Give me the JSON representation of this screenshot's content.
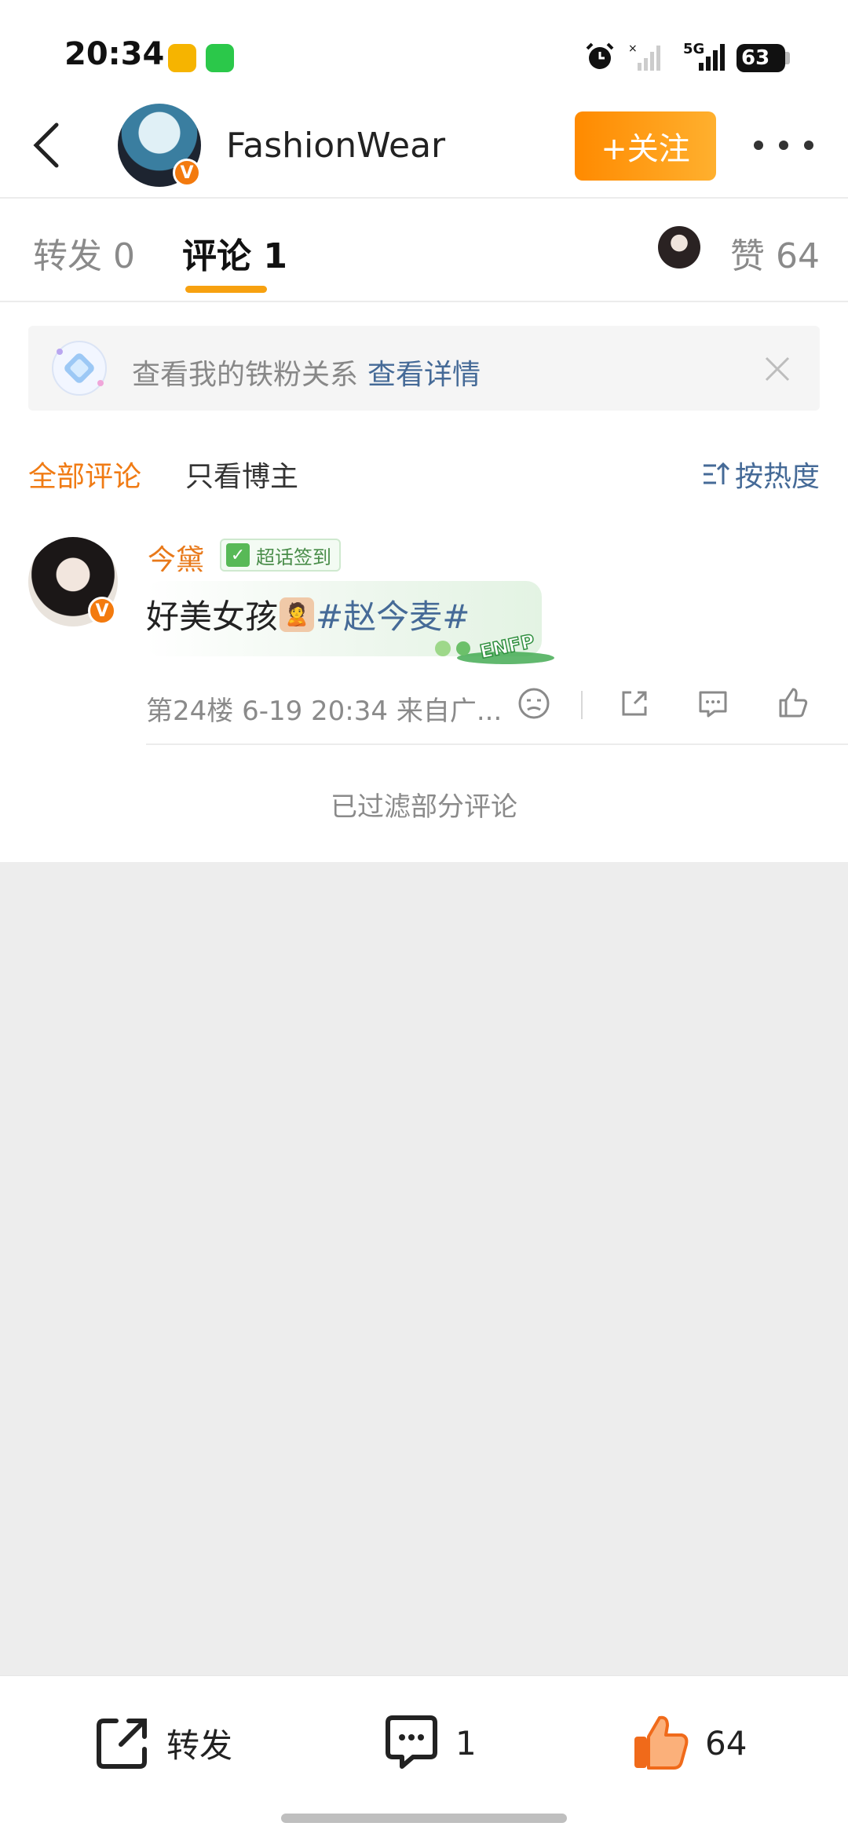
{
  "status_bar": {
    "time": "20:34",
    "battery": "63",
    "network": "5G"
  },
  "header": {
    "account_name": "FashionWear",
    "follow_label": "+关注",
    "verified_mark": "V"
  },
  "tabs": {
    "repost": "转发 0",
    "comment": "评论 1",
    "like": "赞 64"
  },
  "banner": {
    "text": "查看我的铁粉关系",
    "link": "查看详情"
  },
  "filter": {
    "all": "全部评论",
    "owner_only": "只看博主",
    "sort": "按热度"
  },
  "comment": {
    "user": "今黛",
    "verified_mark": "V",
    "badge": "超话签到",
    "text": "好美女孩",
    "topic": "#赵今麦#",
    "meta": "第24楼  6-19 20:34  来自广...",
    "sticker_text": "ENFP"
  },
  "filtered_note": "已过滤部分评论",
  "bottom_bar": {
    "repost": "转发",
    "comment_count": "1",
    "like_count": "64"
  },
  "colors": {
    "accent_orange": "#f7a110",
    "link_blue": "#456a97",
    "name_orange": "#e8791a"
  }
}
